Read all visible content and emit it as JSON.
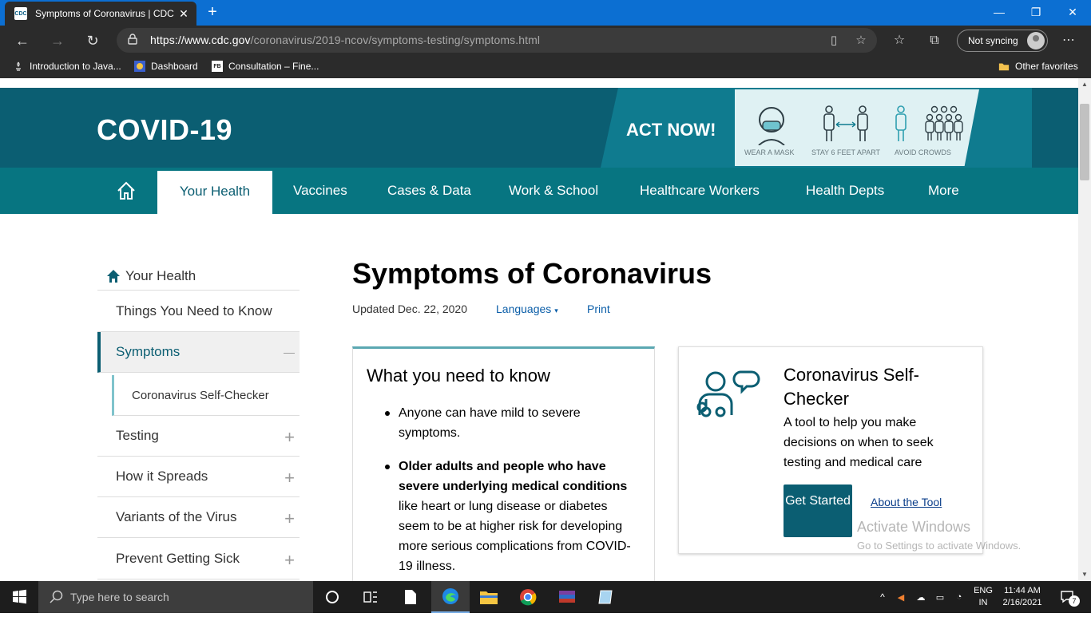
{
  "browser": {
    "tab_title": "Symptoms of Coronavirus | CDC",
    "favicon_text": "CDC",
    "url_host": "https://www.cdc.gov",
    "url_path": "/coronavirus/2019-ncov/symptoms-testing/symptoms.html",
    "sync_label": "Not syncing",
    "bookmarks": [
      {
        "label": "Introduction to Java..."
      },
      {
        "label": "Dashboard"
      },
      {
        "label": "Consultation – Fine..."
      }
    ],
    "bookmark_fb_text": "FB",
    "other_favorites": "Other favorites"
  },
  "banner": {
    "title": "COVID-19",
    "act_now": "ACT NOW!",
    "captions": [
      "WEAR A MASK",
      "STAY 6 FEET APART",
      "AVOID CROWDS"
    ]
  },
  "nav": {
    "items": [
      {
        "label": "Your Health"
      },
      {
        "label": "Vaccines"
      },
      {
        "label": "Cases & Data"
      },
      {
        "label": "Work & School"
      },
      {
        "label": "Healthcare Workers"
      },
      {
        "label": "Health Depts"
      },
      {
        "label": "More"
      }
    ]
  },
  "sidebar": {
    "heading": "Your Health",
    "items": [
      {
        "label": "Things You Need to Know",
        "toggle": ""
      },
      {
        "label": "Symptoms",
        "toggle": "—"
      },
      {
        "label": "Coronavirus Self-Checker",
        "toggle": ""
      },
      {
        "label": "Testing",
        "toggle": "+"
      },
      {
        "label": "How it Spreads",
        "toggle": "+"
      },
      {
        "label": "Variants of the Virus",
        "toggle": "+"
      },
      {
        "label": "Prevent Getting Sick",
        "toggle": "+"
      }
    ]
  },
  "main": {
    "title": "Symptoms of Coronavirus",
    "updated": "Updated Dec. 22, 2020",
    "languages": "Languages",
    "print": "Print",
    "need_box": {
      "heading": "What you need to know",
      "bullet1": "Anyone can have mild to severe symptoms.",
      "bullet2_bold": "Older adults and people who have severe underlying medical conditions",
      "bullet2_rest": " like heart or lung disease or diabetes seem to be at higher risk for developing more serious complications from COVID-19 illness."
    },
    "self_checker": {
      "title": "Coronavirus Self-Checker",
      "description": "A tool to help you make decisions on when to seek testing and medical care",
      "button": "Get Started",
      "about_link": "About the Tool"
    }
  },
  "watermark": {
    "line1": "Activate Windows",
    "line2": "Go to Settings to activate Windows."
  },
  "taskbar": {
    "search_placeholder": "Type here to search",
    "lang_top": "ENG",
    "lang_bottom": "IN",
    "time": "11:44 AM",
    "date": "2/16/2021",
    "notification_count": "7"
  },
  "colors": {
    "cdc_dark_teal": "#0b5e72",
    "cdc_nav_teal": "#077581",
    "link_blue": "#0b5ea8",
    "browser_tab_blue": "#0c6fd2"
  }
}
